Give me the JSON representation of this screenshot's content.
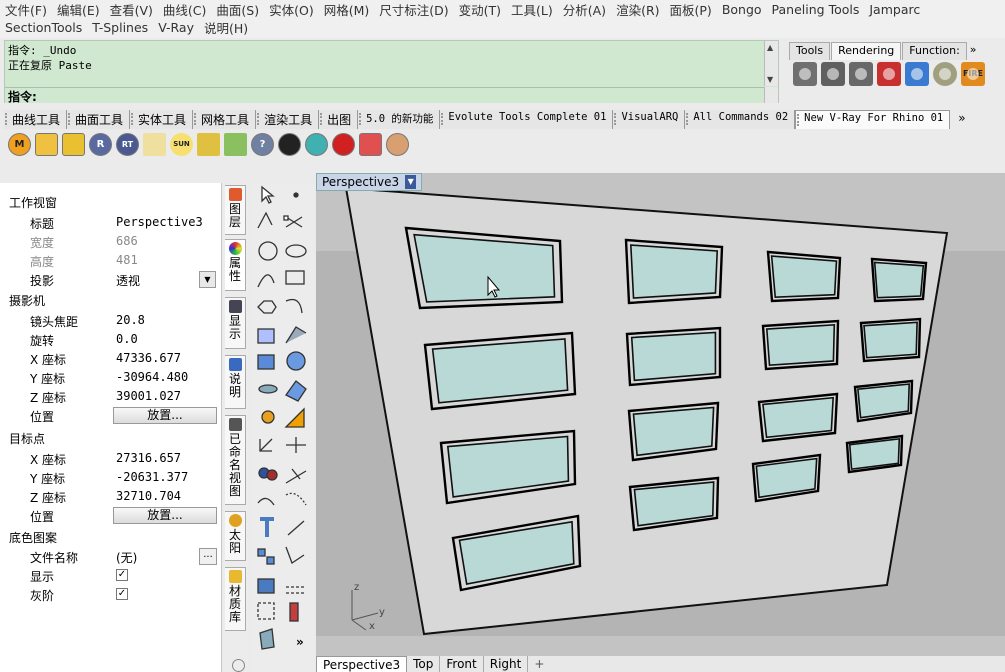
{
  "menubar": {
    "row1": [
      "文件(F)",
      "编辑(E)",
      "查看(V)",
      "曲线(C)",
      "曲面(S)",
      "实体(O)",
      "网格(M)",
      "尺寸标注(D)",
      "变动(T)",
      "工具(L)",
      "分析(A)",
      "渲染(R)",
      "面板(P)",
      "Bongo",
      "Paneling Tools",
      "Jamparc"
    ],
    "row2": [
      "SectionTools",
      "T-Splines",
      "V-Ray",
      "说明(H)"
    ]
  },
  "command": {
    "line1": "指令: _Undo",
    "line2": "正在复原 Paste",
    "prompt": "指令:"
  },
  "right_panel": {
    "tabs": [
      "Tools",
      "Rendering",
      "Function:"
    ],
    "more": "»",
    "fire_label": "FIRE"
  },
  "toolbar_tabs": [
    "曲线工具",
    "曲面工具",
    "实体工具",
    "网格工具",
    "渲染工具",
    "出图",
    "5.0 的新功能",
    "Evolute Tools Complete 01",
    "VisualARQ",
    "All Commands 02",
    "New V-Ray For Rhino 01"
  ],
  "toolbar_more": "»",
  "toolbar_icons": [
    "M",
    "R",
    "RT",
    "SUN"
  ],
  "properties": {
    "section_viewport": "工作视窗",
    "title_label": "标题",
    "title_value": "Perspective3",
    "width_label": "宽度",
    "width_value": "686",
    "height_label": "高度",
    "height_value": "481",
    "projection_label": "投影",
    "projection_value": "透视",
    "section_camera": "摄影机",
    "lens_label": "镜头焦距",
    "lens_value": "20.8",
    "rotation_label": "旋转",
    "rotation_value": "0.0",
    "cam_x_label": "X 座标",
    "cam_x_value": "47336.677",
    "cam_y_label": "Y 座标",
    "cam_y_value": "-30964.480",
    "cam_z_label": "Z 座标",
    "cam_z_value": "39001.027",
    "cam_pos_label": "位置",
    "place_button": "放置...",
    "section_target": "目标点",
    "tgt_x_label": "X 座标",
    "tgt_x_value": "27316.657",
    "tgt_y_label": "Y 座标",
    "tgt_y_value": "-20631.377",
    "tgt_z_label": "Z 座标",
    "tgt_z_value": "32710.704",
    "tgt_pos_label": "位置",
    "section_wallpaper": "底色图案",
    "filename_label": "文件名称",
    "filename_value": "(无)",
    "show_label": "显示",
    "gray_label": "灰阶",
    "check_mark": "✓",
    "dots_label": "..."
  },
  "side_tabs": [
    "图层",
    "属性",
    "显示",
    "说明",
    "已命名视图",
    "太阳",
    "材质库"
  ],
  "vtools_more": "»",
  "viewport": {
    "label": "Perspective3",
    "axis_x": "x",
    "axis_y": "y",
    "axis_z": "z"
  },
  "viewport_tabs": [
    "Perspective3",
    "Top",
    "Front",
    "Right"
  ],
  "add_tab": "+",
  "colors": {
    "command_bg": "#cfe8cf",
    "viewport_bg": "#c3c3c3",
    "wall": "#d8d8d8",
    "glass": "#b9d9d6"
  }
}
